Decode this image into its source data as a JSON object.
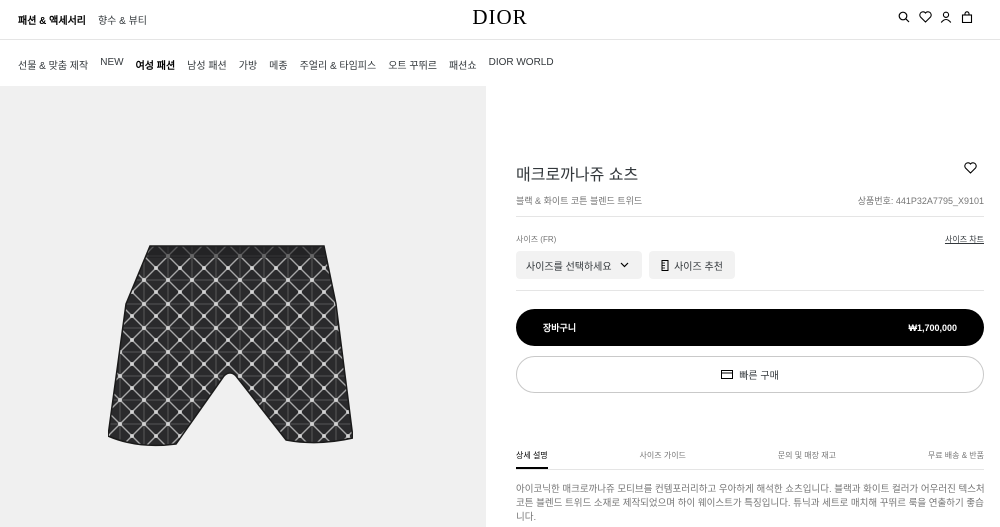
{
  "header": {
    "categories": [
      "패션 & 액세서리",
      "향수 & 뷰티"
    ],
    "logo": "DIOR",
    "icons": [
      "search-icon",
      "heart-icon",
      "user-icon",
      "bag-icon"
    ]
  },
  "nav": {
    "items": [
      "선물 & 맞춤 제작",
      "NEW",
      "여성 패션",
      "남성 패션",
      "가방",
      "메종",
      "주얼리 & 타임피스",
      "오트 꾸뛰르",
      "패션쇼",
      "DIOR WORLD"
    ],
    "active_index": 2
  },
  "product": {
    "name": "매크로까나쥬 쇼츠",
    "subtitle": "블랙 & 화이트 코튼 블렌드 트위드",
    "ref": "상품번호: 441P32A7795_X9101",
    "size_label": "사이즈 (FR)",
    "size_chart": "사이즈 차트",
    "size_select": "사이즈를 선택하세요",
    "size_recommend": "사이즈 추천",
    "cart_label": "장바구니",
    "price": "₩1,700,000",
    "quick_buy": "빠른 구매",
    "tabs": [
      "상세 설명",
      "사이즈 가이드",
      "문의 및 매장 재고",
      "무료 배송 & 반품"
    ],
    "description": "아이코닉한 매크로까나쥬 모티브를 컨템포러리하고 우아하게 해석한 쇼츠입니다. 블랙과 화이트 컬러가 어우러진 텍스처 코튼 블렌드 트위드 소재로 제작되었으며 하이 웨이스트가 특징입니다. 튜닉과 세트로 매치해 꾸뛰르 룩을 연출하기 좋습니다."
  },
  "colors": {
    "accent": "#000000",
    "panel_bg": "#f0f0f0"
  }
}
